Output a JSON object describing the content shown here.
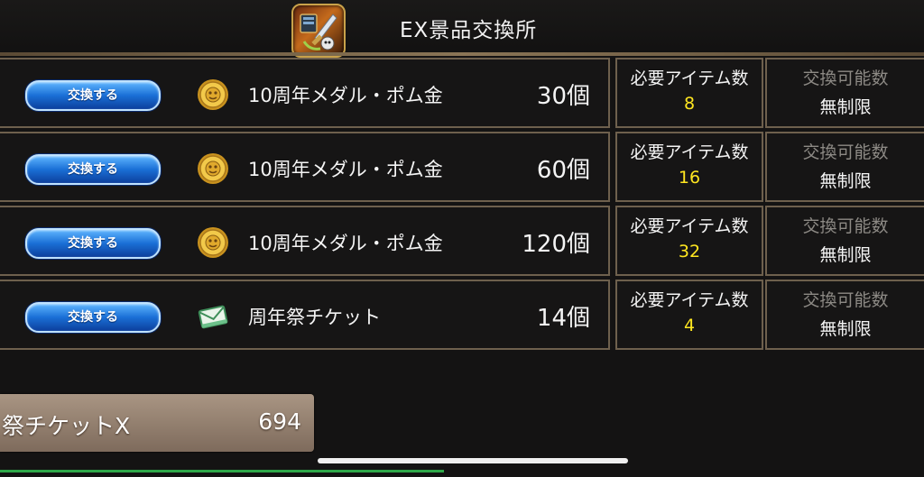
{
  "header": {
    "title": "EX景品交換所",
    "icon": "weapon-shop-icon"
  },
  "rows": [
    {
      "button_label": "交換する",
      "item_icon": "gold-medal-icon",
      "item_name": "10周年メダル・ポム金",
      "count": "30個",
      "required_label": "必要アイテム数",
      "required_value": "8",
      "available_label": "交換可能数",
      "available_value": "無制限"
    },
    {
      "button_label": "交換する",
      "item_icon": "gold-medal-icon",
      "item_name": "10周年メダル・ポム金",
      "count": "60個",
      "required_label": "必要アイテム数",
      "required_value": "16",
      "available_label": "交換可能数",
      "available_value": "無制限"
    },
    {
      "button_label": "交換する",
      "item_icon": "gold-medal-icon",
      "item_name": "10周年メダル・ポム金",
      "count": "120個",
      "required_label": "必要アイテム数",
      "required_value": "32",
      "available_label": "交換可能数",
      "available_value": "無制限"
    },
    {
      "button_label": "交換する",
      "item_icon": "ticket-envelope-icon",
      "item_name": "周年祭チケット",
      "count": "14個",
      "required_label": "必要アイテム数",
      "required_value": "4",
      "available_label": "交換可能数",
      "available_value": "無制限"
    }
  ],
  "footer": {
    "label": "祭チケットX",
    "count": "694"
  },
  "colors": {
    "required_value": "#ffe620",
    "available_label": "#8d8a85",
    "button": "#1a6fd6",
    "frame": "#6e604d"
  }
}
